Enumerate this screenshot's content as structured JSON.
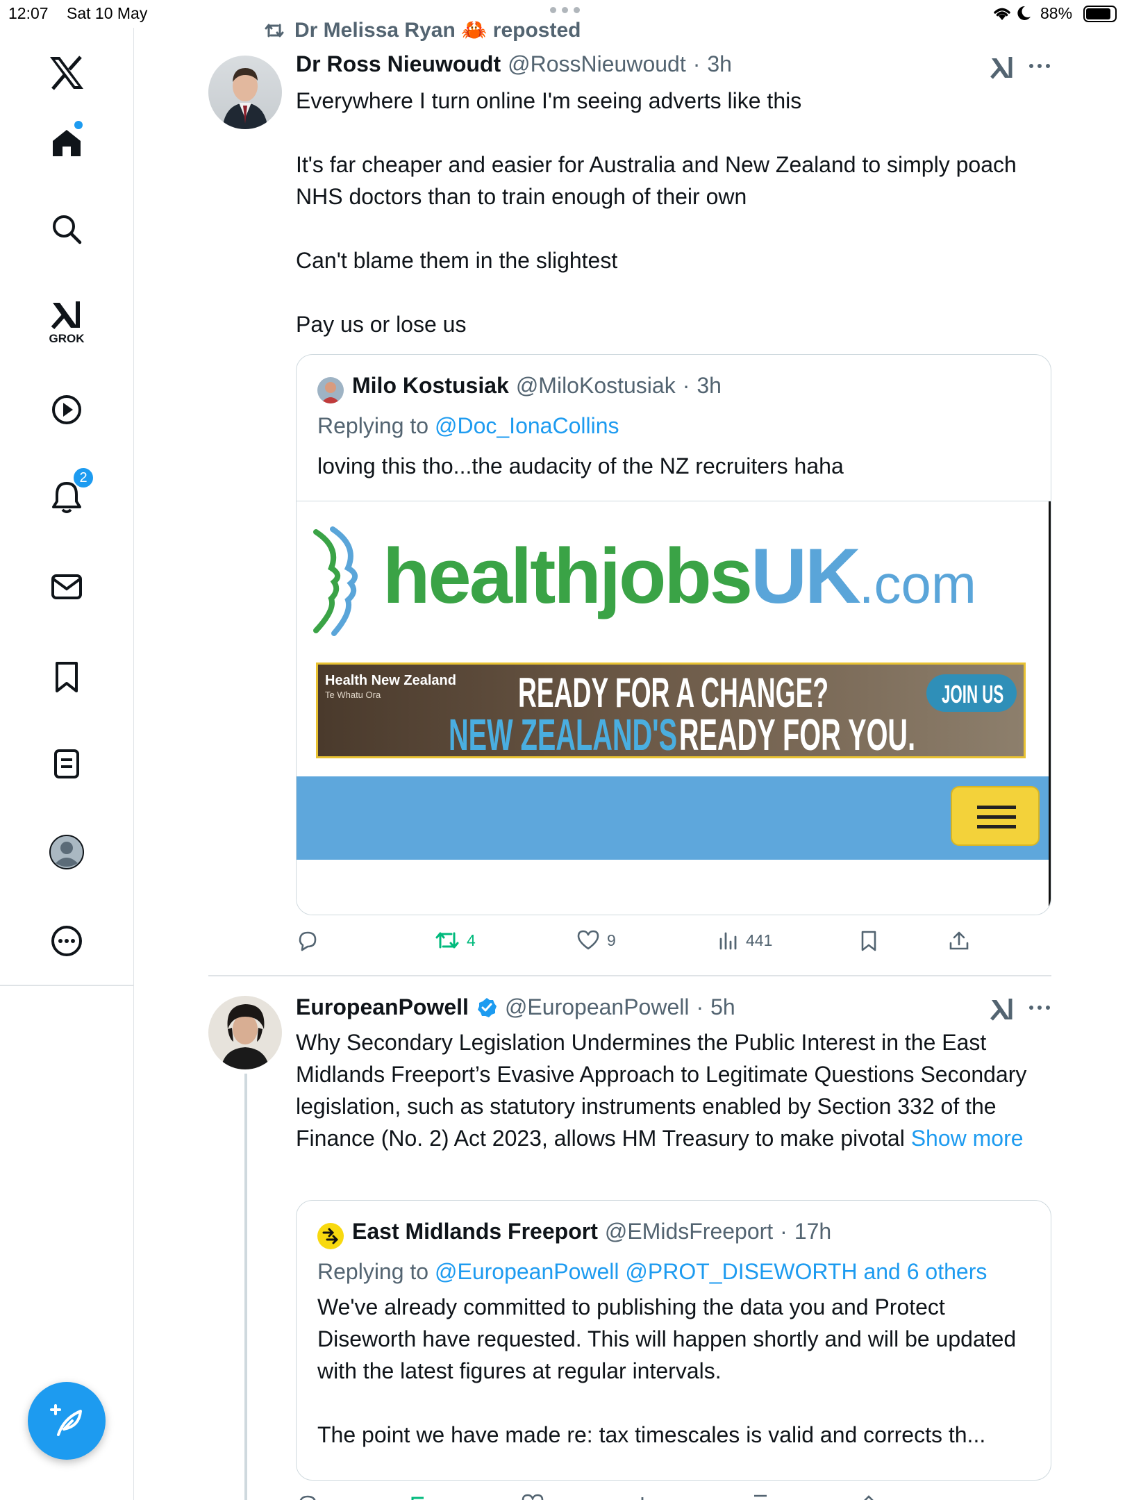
{
  "status_bar": {
    "time": "12:07",
    "date": "Sat 10 May",
    "battery": "88%"
  },
  "sidebar": {
    "items": [
      {
        "name": "x-logo"
      },
      {
        "name": "home"
      },
      {
        "name": "search"
      },
      {
        "name": "grok",
        "label": "GROK"
      },
      {
        "name": "videos"
      },
      {
        "name": "notifications",
        "badge": "2"
      },
      {
        "name": "messages"
      },
      {
        "name": "bookmarks"
      },
      {
        "name": "lists"
      },
      {
        "name": "profile"
      },
      {
        "name": "more"
      }
    ]
  },
  "colors": {
    "accent": "#1d9bf0",
    "retweet": "#00ba7c",
    "healthjobs_green": "#3aa346",
    "healthjobs_blue": "#5aa5d9",
    "site_band": "#5ea7dc",
    "menu_button": "#f3d23a"
  },
  "post1": {
    "repost_label": "Dr Melissa Ryan 🦀 reposted",
    "author_name": "Dr Ross Nieuwoudt",
    "handle": "@RossNieuwoudt",
    "time": "3h",
    "text": "Everywhere I turn online I'm seeing adverts like this\n\nIt's far cheaper and easier for Australia and New Zealand to simply poach NHS doctors than to train enough of their own\n\nCan't blame them in the slightest\n\nPay us or lose us",
    "quote": {
      "author_name": "Milo Kostusiak",
      "handle": "@MiloKostusiak",
      "time": "3h",
      "replying_label": "Replying to",
      "replying_to": "@Doc_IonaCollins",
      "text": "loving this tho...the audacity of the NZ recruiters haha",
      "image": {
        "logo_main": "healthjobs",
        "logo_uk": "UK",
        "logo_tld": ".com",
        "banner_org": "Health New Zealand",
        "banner_org_sub": "Te Whatu Ora",
        "banner_line1": "READY FOR A CHANGE?",
        "banner_line2_a": "NEW ZEALAND'S",
        "banner_line2_b": "READY FOR YOU.",
        "banner_button": "JOIN US"
      }
    },
    "actions": {
      "replies": "",
      "reposts": "4",
      "likes": "9",
      "views": "441"
    }
  },
  "post2": {
    "author_name": "EuropeanPowell",
    "handle": "@EuropeanPowell",
    "time": "5h",
    "text": "Why Secondary Legislation Undermines the Public Interest in the East Midlands Freeport’s Evasive Approach to Legitimate Questions Secondary legislation, such as statutory instruments enabled by Section 332 of the Finance (No. 2) Act 2023, allows HM Treasury to make pivotal",
    "show_more": "Show more",
    "quote": {
      "author_name": "East Midlands Freeport",
      "handle": "@EMidsFreeport",
      "time": "17h",
      "replying_label": "Replying to",
      "replying_to": "@EuropeanPowell @PROT_DISEWORTH and 6 others",
      "text": "We've already committed to publishing the data you and Protect Diseworth have requested. This will happen shortly and will be updated with the latest figures at regular intervals.\n\nThe point we have made re: tax timescales is valid and corrects th..."
    }
  }
}
